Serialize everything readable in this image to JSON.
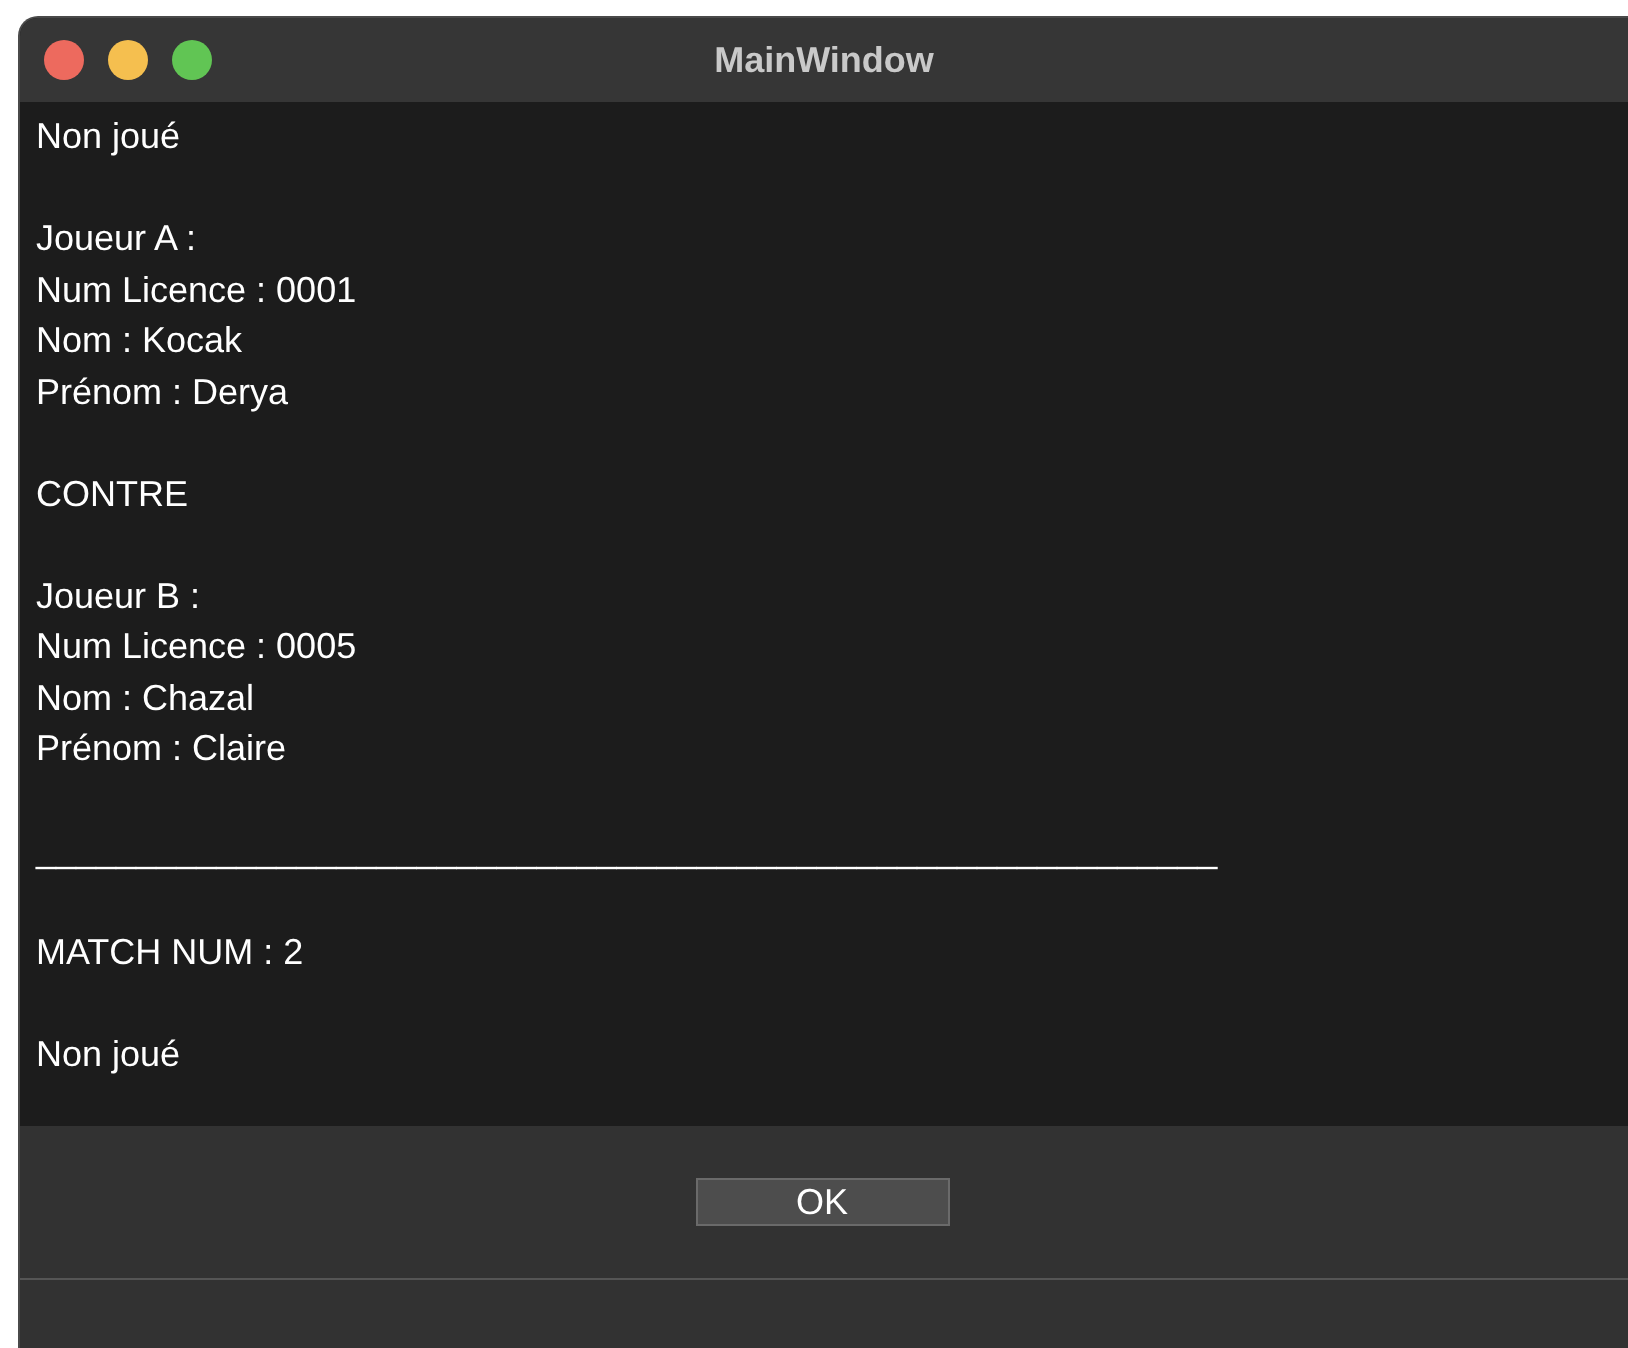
{
  "window": {
    "title": "MainWindow"
  },
  "paragraphs": [
    [
      "Non joué"
    ],
    [
      "Joueur A :",
      "Num Licence : 0001",
      "Nom : Kocak",
      "Prénom : Derya"
    ],
    [
      "CONTRE"
    ],
    [
      "Joueur B :",
      "Num Licence : 0005",
      "Nom : Chazal",
      "Prénom : Claire"
    ],
    [
      "___________________________________________________________"
    ],
    [
      "MATCH NUM : 2"
    ],
    [
      "Non joué"
    ]
  ],
  "buttons": [
    "OK"
  ]
}
